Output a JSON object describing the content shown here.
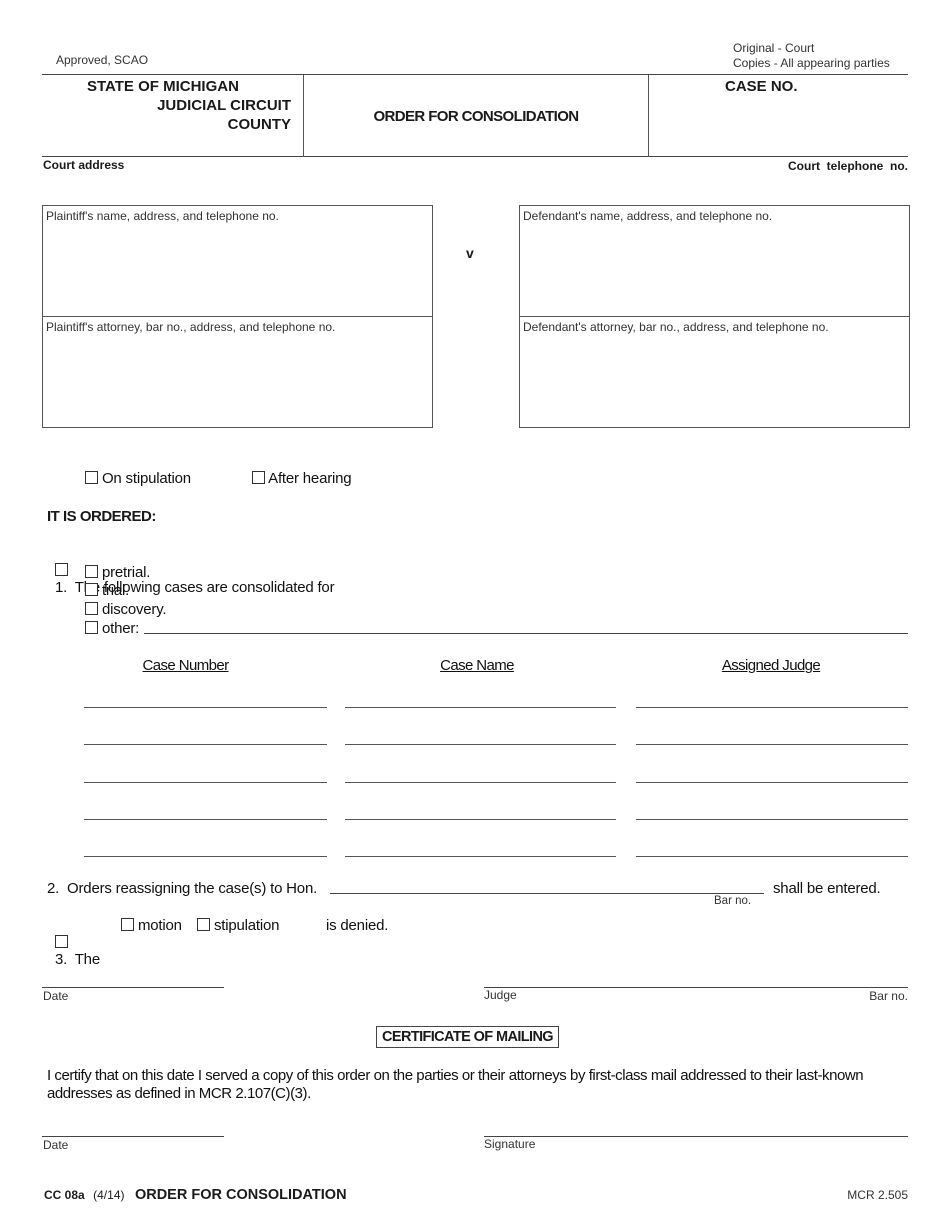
{
  "header": {
    "approved": "Approved, SCAO",
    "distribution_line1": "Original - Court",
    "distribution_line2": "Copies - All appearing parties",
    "court_line1": "STATE OF MICHIGAN",
    "court_line2": "JUDICIAL CIRCUIT",
    "court_line3": "COUNTY",
    "form_title": "ORDER FOR CONSOLIDATION",
    "case_no_label": "CASE NO.",
    "court_address_label": "Court  address",
    "court_phone_label": "Court  telephone  no."
  },
  "parties": {
    "plaintiff_name_label": "Plaintiff's name, address, and telephone no.",
    "plaintiff_attorney_label": "Plaintiff's attorney, bar no., address, and telephone no.",
    "versus": "v",
    "defendant_name_label": "Defendant's name, address, and telephone no.",
    "defendant_attorney_label": "Defendant's attorney, bar no., address, and telephone no."
  },
  "basis": {
    "on_stipulation": "On stipulation",
    "after_hearing": "After hearing"
  },
  "order": {
    "heading": "IT IS ORDERED:",
    "item1_text": "1.  The following cases are consolidated for",
    "options": [
      "pretrial.",
      "trial.",
      "discovery.",
      "other:"
    ],
    "table": {
      "columns": [
        "Case Number",
        "Case Name",
        "Assigned Judge"
      ],
      "rows": [
        [
          "",
          "",
          ""
        ],
        [
          "",
          "",
          ""
        ],
        [
          "",
          "",
          ""
        ],
        [
          "",
          "",
          ""
        ],
        [
          "",
          "",
          ""
        ]
      ]
    },
    "item2_text": "2.  Orders reassigning the case(s) to Hon.",
    "item2_bar_label": "Bar no.",
    "item2_suffix": "shall be entered.",
    "item3_prefix": "3.  The",
    "item3_motion": "motion",
    "item3_stipulation": "stipulation",
    "item3_suffix": "is denied."
  },
  "signature": {
    "date_label": "Date",
    "judge_label": "Judge",
    "bar_label": "Bar no."
  },
  "certificate": {
    "heading": "CERTIFICATE OF MAILING",
    "text": "I certify that on this date I served a copy of this order on the parties or their attorneys by first-class mail addressed to their last-known addresses as defined in MCR 2.107(C)(3).",
    "date_label": "Date",
    "signature_label": "Signature"
  },
  "footer": {
    "form_code": "CC 08a",
    "revision": "(4/14)",
    "title": "ORDER FOR CONSOLIDATION",
    "rule": "MCR 2.505"
  }
}
